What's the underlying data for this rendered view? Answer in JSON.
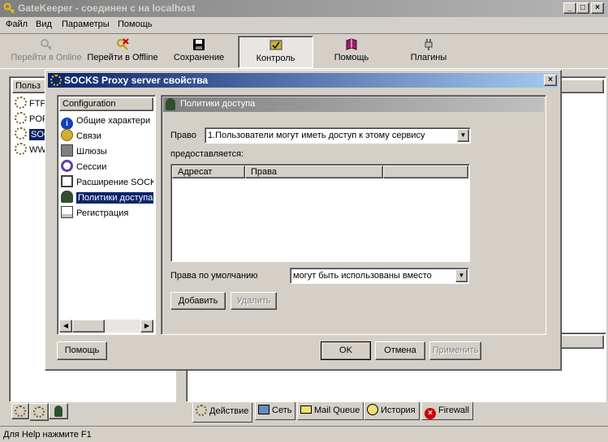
{
  "app": {
    "title": "GateKeeper - соединен с на localhost",
    "caption_buttons": [
      "_",
      "□",
      "×"
    ]
  },
  "menu": [
    "Файл",
    "Вид",
    "Параметры",
    "Помощь"
  ],
  "toolbar": [
    {
      "label": "Перейти в Online",
      "icon": "key-icon",
      "enabled": false
    },
    {
      "label": "Перейти в Offline",
      "icon": "key-cross-icon",
      "enabled": true
    },
    {
      "label": "Сохранение",
      "icon": "floppy-disk-icon",
      "enabled": true
    },
    {
      "label": "Контроль",
      "icon": "monitor-check-icon",
      "enabled": true,
      "active": true
    },
    {
      "label": "Помощь",
      "icon": "help-book-icon",
      "enabled": true
    },
    {
      "label": "Плагины",
      "icon": "plug-icon",
      "enabled": true
    }
  ],
  "left_pane": {
    "header": "Польз",
    "items": [
      "FTP",
      "POP",
      "SOC",
      "WW"
    ]
  },
  "bottom_tabs": [
    "Действие",
    "Сеть",
    "Mail Queue",
    "История",
    "Firewall"
  ],
  "status": "Для Help нажмите F1",
  "dialog": {
    "title": "SOCKS Proxy server свойства",
    "close": "×",
    "tree_header": "Configuration",
    "tree_items": [
      {
        "label": "Общие характери",
        "icon": "info-icon"
      },
      {
        "label": "Связи",
        "icon": "connections-icon"
      },
      {
        "label": "Шлюзы",
        "icon": "gateway-icon"
      },
      {
        "label": "Сессии",
        "icon": "sessions-icon"
      },
      {
        "label": "Расширение SOCKS",
        "icon": "extension-icon"
      },
      {
        "label": "Политики доступа",
        "icon": "user-policy-icon",
        "selected": true
      },
      {
        "label": "Регистрация",
        "icon": "log-icon"
      }
    ],
    "panel_title": "Политики доступа",
    "right_label": "Право",
    "right_value": "1.Пользователи могут иметь доступ к этому сервису",
    "granted_label": "предоставляется:",
    "columns": [
      "Адресат",
      "Права"
    ],
    "default_label": "Права по умолчанию",
    "default_value": "могут быть использованы вместо",
    "add_button": "Добавить",
    "delete_button": "Удалить",
    "help_button": "Помощь",
    "ok_button": "OK",
    "cancel_button": "Отмена",
    "apply_button": "Применить"
  },
  "colors": {
    "face": "#d4d0c8",
    "dialog_title_start": "#0a246a",
    "dialog_title_end": "#a6caf0",
    "inactive_title": "#808080",
    "selection": "#0a246a"
  }
}
